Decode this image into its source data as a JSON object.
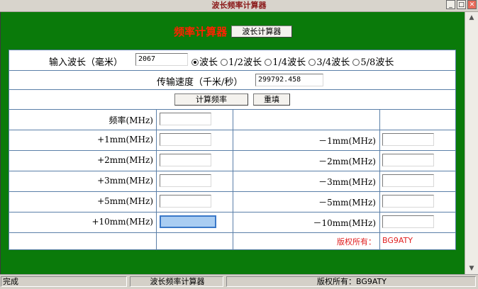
{
  "window": {
    "title": "波长频率计算器",
    "minimize": "_",
    "maximize": "□",
    "close": "✕"
  },
  "heading": {
    "title": "频率计算器",
    "button": "波长计算器"
  },
  "form": {
    "wavelength_label": "输入波长（毫米）",
    "wavelength_value": "2067",
    "options": [
      "波长",
      "1/2波长",
      "1/4波长",
      "3/4波长",
      "5/8波长"
    ],
    "selected_option": "波长",
    "speed_label": "传输速度（千米/秒）",
    "speed_value": "299792.458",
    "calc_button": "计算频率",
    "reset_button": "重填"
  },
  "results": {
    "freq_label": "频率(MHz)",
    "plus": [
      "+1mm(MHz)",
      "+2mm(MHz)",
      "+3mm(MHz)",
      "+5mm(MHz)",
      "+10mm(MHz)"
    ],
    "minus": [
      "－1mm(MHz)",
      "－2mm(MHz)",
      "－3mm(MHz)",
      "－5mm(MHz)",
      "－10mm(MHz)"
    ]
  },
  "copyright": {
    "label": "版权所有：",
    "value": "BG9ATY"
  },
  "statusbar": {
    "status": "完成",
    "page": "波长频率计算器",
    "copyright": "版权所有：BG9ATY"
  },
  "colors": {
    "background": "#0a7a0a",
    "heading_red": "#ff2200",
    "border_blue": "#5a7fa8",
    "copyright_red": "#e02020"
  }
}
